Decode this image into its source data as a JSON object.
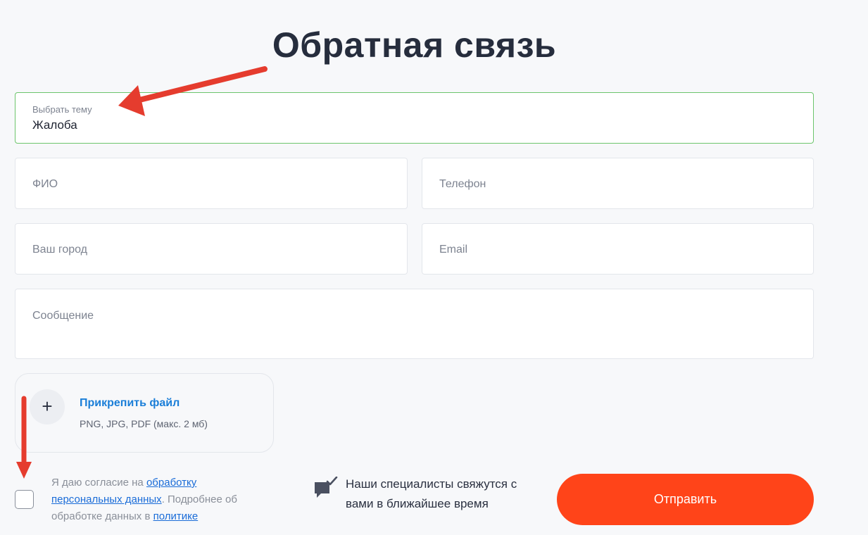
{
  "page": {
    "title": "Обратная связь"
  },
  "form": {
    "topic": {
      "label": "Выбрать тему",
      "value": "Жалоба"
    },
    "name_placeholder": "ФИО",
    "phone_placeholder": "Телефон",
    "city_placeholder": "Ваш город",
    "email_placeholder": "Email",
    "message_placeholder": "Сообщение",
    "attach": {
      "icon": "plus-icon",
      "title": "Прикрепить файл",
      "hint": "PNG, JPG, PDF (макс. 2 мб)"
    },
    "consent": {
      "checked": false,
      "text1": "Я даю согласие на ",
      "link1": "обработку персональных данных",
      "text2": ". Подробнее об обработке данных в ",
      "link2": "политике"
    },
    "info": {
      "icon": "chat-check-icon",
      "text": "Наши специалисты свяжутся с вами в ближайшее время"
    },
    "submit_label": "Отправить"
  },
  "annotations": {
    "arrow_color": "#e53c2e"
  },
  "colors": {
    "accent": "#ff4419",
    "link": "#1a6cd8",
    "focus_border": "#6cc56c"
  }
}
